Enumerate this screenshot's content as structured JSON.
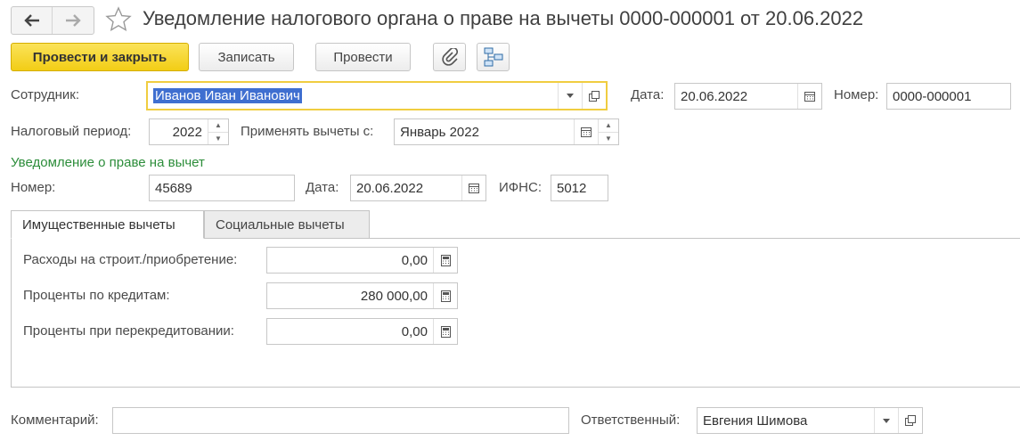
{
  "window": {
    "title": "Уведомление налогового органа о праве на вычеты 0000-000001 от 20.06.2022",
    "nav": {
      "back_icon": "arrow-left-icon",
      "forward_icon": "arrow-right-icon",
      "favorite_icon": "star-icon"
    }
  },
  "toolbar": {
    "post_and_close": "Провести и закрыть",
    "save": "Записать",
    "post": "Провести",
    "attach_icon": "paperclip-icon",
    "structure_icon": "document-structure-icon"
  },
  "header": {
    "employee_label": "Сотрудник:",
    "employee_value": "Иванов Иван Иванович",
    "date_label": "Дата:",
    "date_value": "20.06.2022",
    "number_label": "Номер:",
    "number_value": "0000-000001",
    "tax_period_label": "Налоговый период:",
    "tax_period_value": "2022",
    "apply_from_label": "Применять вычеты с:",
    "apply_from_value": "Январь 2022"
  },
  "notice": {
    "section_title": "Уведомление о праве на вычет",
    "number_label": "Номер:",
    "number_value": "45689",
    "date_label": "Дата:",
    "date_value": "20.06.2022",
    "ifns_label": "ИФНС:",
    "ifns_value": "5012"
  },
  "tabs": [
    {
      "label": "Имущественные вычеты",
      "active": true
    },
    {
      "label": "Социальные вычеты",
      "active": false
    }
  ],
  "property": {
    "expenses_label": "Расходы на строит./приобретение:",
    "expenses_value": "0,00",
    "interest_label": "Проценты по кредитам:",
    "interest_value": "280 000,00",
    "refinance_label": "Проценты при перекредитовании:",
    "refinance_value": "0,00"
  },
  "footer": {
    "comment_label": "Комментарий:",
    "comment_value": "",
    "responsible_label": "Ответственный:",
    "responsible_value": "Евгения Шимова"
  },
  "colors": {
    "accent_yellow": "#f2cd15",
    "section_green": "#2c8d3a",
    "selection_blue": "#3f6fd0"
  }
}
